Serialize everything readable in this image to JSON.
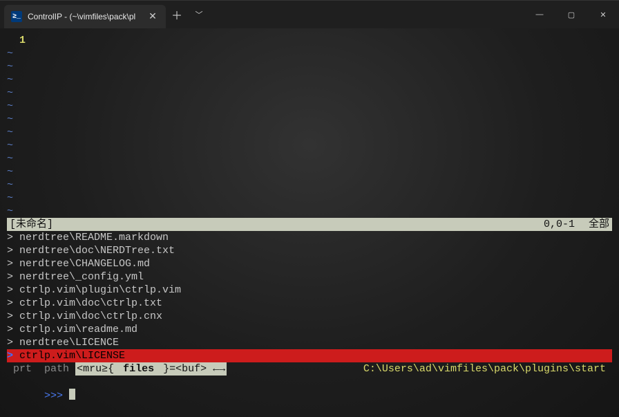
{
  "window": {
    "tab_title": "ControlIP - (~\\vimfiles\\pack\\pl",
    "icon_label": "≥_"
  },
  "editor": {
    "line_number": "1",
    "tilde_count": 13
  },
  "statusline": {
    "name": "[未命名]",
    "pos": "0,0-1",
    "pct": "全部"
  },
  "results": [
    "nerdtree\\README.markdown",
    "nerdtree\\doc\\NERDTree.txt",
    "nerdtree\\CHANGELOG.md",
    "nerdtree\\_config.yml",
    "ctrlp.vim\\plugin\\ctrlp.vim",
    "ctrlp.vim\\doc\\ctrlp.txt",
    "ctrlp.vim\\doc\\ctrlp.cnx",
    "ctrlp.vim\\readme.md",
    "nerdtree\\LICENCE",
    "ctrlp.vim\\LICENSE"
  ],
  "selected_index": 9,
  "modebar": {
    "prt": "prt",
    "path": "path",
    "mode_pre": "<mru≥{",
    "mode_cur": " files ",
    "mode_post": "}=<buf> ←→",
    "cwd": "C:\\Users\\ad\\vimfiles\\pack\\plugins\\start"
  },
  "prompt": ">>> "
}
